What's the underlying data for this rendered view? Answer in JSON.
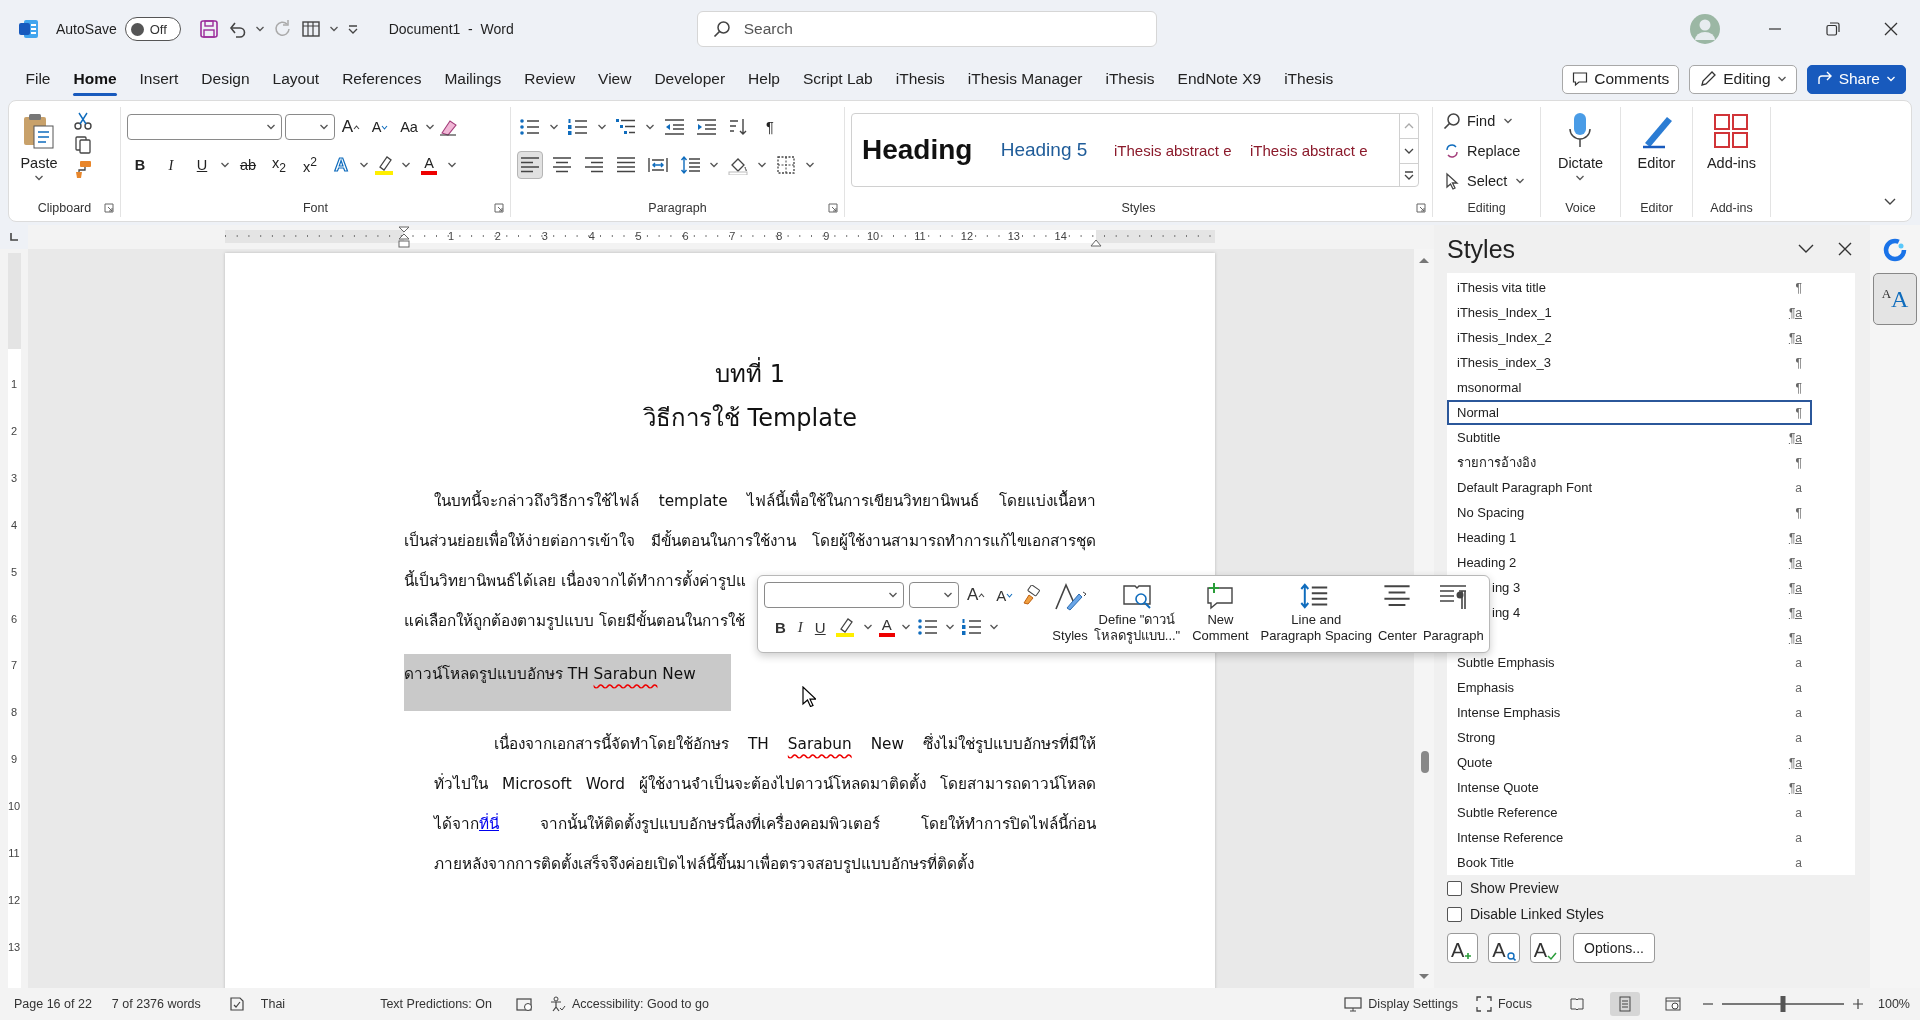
{
  "title_bar": {
    "autosave_label": "AutoSave",
    "autosave": {
      "on": false,
      "text": "Off"
    },
    "title": "Document1  -  Word",
    "search_placeholder": "Search"
  },
  "tabs": [
    {
      "label": "File",
      "selected": false
    },
    {
      "label": "Home",
      "selected": true
    },
    {
      "label": "Insert",
      "selected": false
    },
    {
      "label": "Design",
      "selected": false
    },
    {
      "label": "Layout",
      "selected": false
    },
    {
      "label": "References",
      "selected": false
    },
    {
      "label": "Mailings",
      "selected": false
    },
    {
      "label": "Review",
      "selected": false
    },
    {
      "label": "View",
      "selected": false
    },
    {
      "label": "Developer",
      "selected": false
    },
    {
      "label": "Help",
      "selected": false
    },
    {
      "label": "Script Lab",
      "selected": false
    },
    {
      "label": "iThesis",
      "selected": false
    },
    {
      "label": "iThesis Manager",
      "selected": false
    },
    {
      "label": "iThesis",
      "selected": false
    },
    {
      "label": "EndNote X9",
      "selected": false
    },
    {
      "label": "iThesis",
      "selected": false
    }
  ],
  "tab_actions": {
    "comments": "Comments",
    "editing": "Editing",
    "share": "Share"
  },
  "ribbon": {
    "clipboard": {
      "paste": "Paste",
      "label": "Clipboard"
    },
    "font": {
      "grow": "A",
      "shrink": "A",
      "change_case": "Aa",
      "bold": "B",
      "italic": "I",
      "underline": "U",
      "strikethrough": "ab",
      "subscript": "x$_{2}$",
      "superscript": "x$^{2}$",
      "text_effects": "A",
      "font_color": "A",
      "label": "Font"
    },
    "paragraph": {
      "pilcrow": "¶",
      "alignments": [
        {
          "selected": true
        },
        {
          "selected": false
        },
        {
          "selected": false
        },
        {
          "selected": false
        },
        {
          "selected": false
        }
      ],
      "label": "Paragraph"
    },
    "styles": {
      "gallery": [
        {
          "label": "Heading",
          "kind": "heading"
        },
        {
          "label": "Heading 5",
          "kind": "heading5"
        },
        {
          "label": "iThesis abstract e",
          "kind": "abstract"
        },
        {
          "label": "iThesis abstract e",
          "kind": "abstract"
        }
      ],
      "label": "Styles"
    },
    "editing": {
      "find": "Find",
      "replace": "Replace",
      "select": "Select",
      "label": "Editing"
    },
    "voice": {
      "dictate": "Dictate",
      "label": "Voice"
    },
    "editor": {
      "button": "Editor",
      "label": "Editor"
    },
    "addins": {
      "button": "Add-ins",
      "label": "Add-ins"
    }
  },
  "ruler": {
    "numbers": [
      "1",
      "2",
      "3",
      "4",
      "5",
      "6",
      "7",
      "8",
      "9",
      "10",
      "11",
      "12",
      "13",
      "14"
    ]
  },
  "vertical_ruler": {
    "numbers": [
      "1",
      "2",
      "3",
      "4",
      "5",
      "6",
      "7",
      "8",
      "9",
      "10",
      "11",
      "12",
      "13"
    ]
  },
  "document": {
    "chapter": "บทที่ 1",
    "title": "วิธีการใช้ Template",
    "paragraphs": [
      {
        "kind": "lead",
        "selected": false,
        "lines": [
          {
            "covered": false,
            "segments": [
              {
                "kind": "plain",
                "text": "ในบทนี้จะกล่าวถึงวิธีการใช้ไฟล์ template ไฟล์นี้เพื่อใช้ในการเขียนวิทยานิพนธ์ โดยแบ่งเนื้อหา"
              }
            ]
          },
          {
            "covered": false,
            "segments": [
              {
                "kind": "plain",
                "text": "เป็นส่วนย่อยเพื่อให้ง่ายต่อการเข้าใจ มีขั้นตอนในการใช้งาน โดยผู้ใช้งานสามารถทำการแก้ไขเอกสารชุด"
              }
            ]
          },
          {
            "covered": true,
            "segments": [
              {
                "kind": "plain",
                "text": "นี้เป็นวิทยานิพนธ์ได้เลย เนื่องจากได้ทำการตั้งค่ารูปแ"
              }
            ]
          },
          {
            "covered": true,
            "segments": [
              {
                "kind": "plain",
                "text": "แค่เลือกให้ถูกต้องตามรูปแบบ โดยมีขั้นตอนในการใช้"
              }
            ]
          }
        ]
      },
      {
        "kind": "heading",
        "selected": true,
        "lines": [
          {
            "covered": false,
            "segments": [
              {
                "kind": "plain",
                "text": "ดาวน์โหลดรูปแบบอักษร TH "
              },
              {
                "kind": "misspelled",
                "text": "Sarabun"
              },
              {
                "kind": "plain",
                "text": " New"
              }
            ]
          }
        ]
      },
      {
        "kind": "block",
        "selected": false,
        "lines": [
          {
            "covered": false,
            "segments": [
              {
                "kind": "plain",
                "text": "เนื่องจากเอกสารนี้จัดทำโดยใช้อักษร TH "
              },
              {
                "kind": "misspelled",
                "text": "Sarabun"
              },
              {
                "kind": "plain",
                "text": " New ซึ่งไม่ใช่รูปแบบอักษรที่มีให้"
              }
            ]
          },
          {
            "covered": false,
            "segments": [
              {
                "kind": "plain",
                "text": "ทั่วไปใน Microsoft Word ผู้ใช้งานจำเป็นจะต้องไปดาวน์โหลดมาติดตั้ง โดยสามารถดาวน์โหลด"
              }
            ]
          },
          {
            "covered": false,
            "segments": [
              {
                "kind": "plain",
                "text": "ได้จาก"
              },
              {
                "kind": "link",
                "text": "ที่นี่"
              },
              {
                "kind": "plain",
                "text": " จากนั้นให้ติดตั้งรูปแบบอักษรนี้ลงที่เครื่องคอมพิวเตอร์ โดยให้ทำการปิดไฟล์นี้ก่อน"
              }
            ]
          },
          {
            "covered": false,
            "segments": [
              {
                "kind": "plain",
                "text": "ภายหลังจากการติดตั้งเสร็จจึงค่อยเปิดไฟล์นี้ขึ้นมาเพื่อตรวจสอบรูปแบบอักษรที่ติดตั้ง"
              }
            ]
          }
        ]
      }
    ]
  },
  "floating_toolbar": {
    "grow": "A",
    "shrink": "A",
    "bold": "B",
    "italic": "I",
    "underline": "U",
    "font_color": "A",
    "styles": "Styles",
    "define": [
      "Define \"ดาวน์",
      "โหลดรูปแบบ...\""
    ],
    "new_comment": [
      "New",
      "Comment"
    ],
    "spacing": [
      "Line and",
      "Paragraph Spacing"
    ],
    "center": "Center",
    "paragraph": "Paragraph"
  },
  "styles_pane": {
    "title": "Styles",
    "items": [
      {
        "label": "iThesis vita title",
        "kind": "paragraph",
        "symbol": "¶",
        "selected": false,
        "covered": false
      },
      {
        "label": "iThesis_Index_1",
        "kind": "linked",
        "symbol": "¶a",
        "selected": false,
        "covered": false
      },
      {
        "label": "iThesis_Index_2",
        "kind": "linked",
        "symbol": "¶a",
        "selected": false,
        "covered": false
      },
      {
        "label": "iThesis_index_3",
        "kind": "paragraph",
        "symbol": "¶",
        "selected": false,
        "covered": false
      },
      {
        "label": "msonormal",
        "kind": "paragraph",
        "symbol": "¶",
        "selected": false,
        "covered": false
      },
      {
        "label": "Normal",
        "kind": "paragraph",
        "symbol": "¶",
        "selected": true,
        "covered": false
      },
      {
        "label": "Subtitle",
        "kind": "linked",
        "symbol": "¶a",
        "selected": false,
        "covered": false
      },
      {
        "label": "รายการอ้างอิง",
        "kind": "paragraph",
        "symbol": "¶",
        "selected": false,
        "covered": false
      },
      {
        "label": "Default Paragraph Font",
        "kind": "character",
        "symbol": "a",
        "selected": false,
        "covered": false
      },
      {
        "label": "No Spacing",
        "kind": "paragraph",
        "symbol": "¶",
        "selected": false,
        "covered": false
      },
      {
        "label": "Heading 1",
        "kind": "linked",
        "symbol": "¶a",
        "selected": false,
        "covered": false
      },
      {
        "label": "Heading 2",
        "kind": "linked",
        "symbol": "¶a",
        "selected": false,
        "covered": false
      },
      {
        "label": "ing 3",
        "kind": "linked",
        "symbol": "¶a",
        "selected": false,
        "covered": true
      },
      {
        "label": "ing 4",
        "kind": "linked",
        "symbol": "¶a",
        "selected": false,
        "covered": true
      },
      {
        "kind": "linked",
        "symbol": "¶a",
        "selected": false,
        "covered": true
      },
      {
        "label": "Subtle Emphasis",
        "kind": "character",
        "symbol": "a",
        "selected": false,
        "covered": false
      },
      {
        "label": "Emphasis",
        "kind": "character",
        "symbol": "a",
        "selected": false,
        "covered": false
      },
      {
        "label": "Intense Emphasis",
        "kind": "character",
        "symbol": "a",
        "selected": false,
        "covered": false
      },
      {
        "label": "Strong",
        "kind": "character",
        "symbol": "a",
        "selected": false,
        "covered": false
      },
      {
        "label": "Quote",
        "kind": "linked",
        "symbol": "¶a",
        "selected": false,
        "covered": false
      },
      {
        "label": "Intense Quote",
        "kind": "linked",
        "symbol": "¶a",
        "selected": false,
        "covered": false
      },
      {
        "label": "Subtle Reference",
        "kind": "character",
        "symbol": "a",
        "selected": false,
        "covered": false
      },
      {
        "label": "Intense Reference",
        "kind": "character",
        "symbol": "a",
        "selected": false,
        "covered": false
      },
      {
        "label": "Book Title",
        "kind": "character",
        "symbol": "a",
        "selected": false,
        "covered": false
      }
    ],
    "show_preview": {
      "label": "Show Preview",
      "checked": false
    },
    "disable_linked": {
      "label": "Disable Linked Styles",
      "checked": false
    },
    "tool_glyphs": [
      "A",
      "A",
      "A"
    ],
    "options": "Options..."
  },
  "side_rail": {
    "buttons": [
      {
        "selected": false
      },
      {
        "selected": true,
        "glyphs": [
          "A",
          "A"
        ]
      }
    ]
  },
  "status_bar": {
    "page": "Page 16 of 22",
    "words": "7 of 2376 words",
    "language": "Thai",
    "predictions": "Text Predictions: On",
    "accessibility": "Accessibility: Good to go",
    "display_settings": "Display Settings",
    "focus": "Focus",
    "views": [
      {
        "selected": false
      },
      {
        "selected": true
      },
      {
        "selected": false
      }
    ],
    "zoom": {
      "level": 0.5
    },
    "zoom_text": "100%"
  }
}
